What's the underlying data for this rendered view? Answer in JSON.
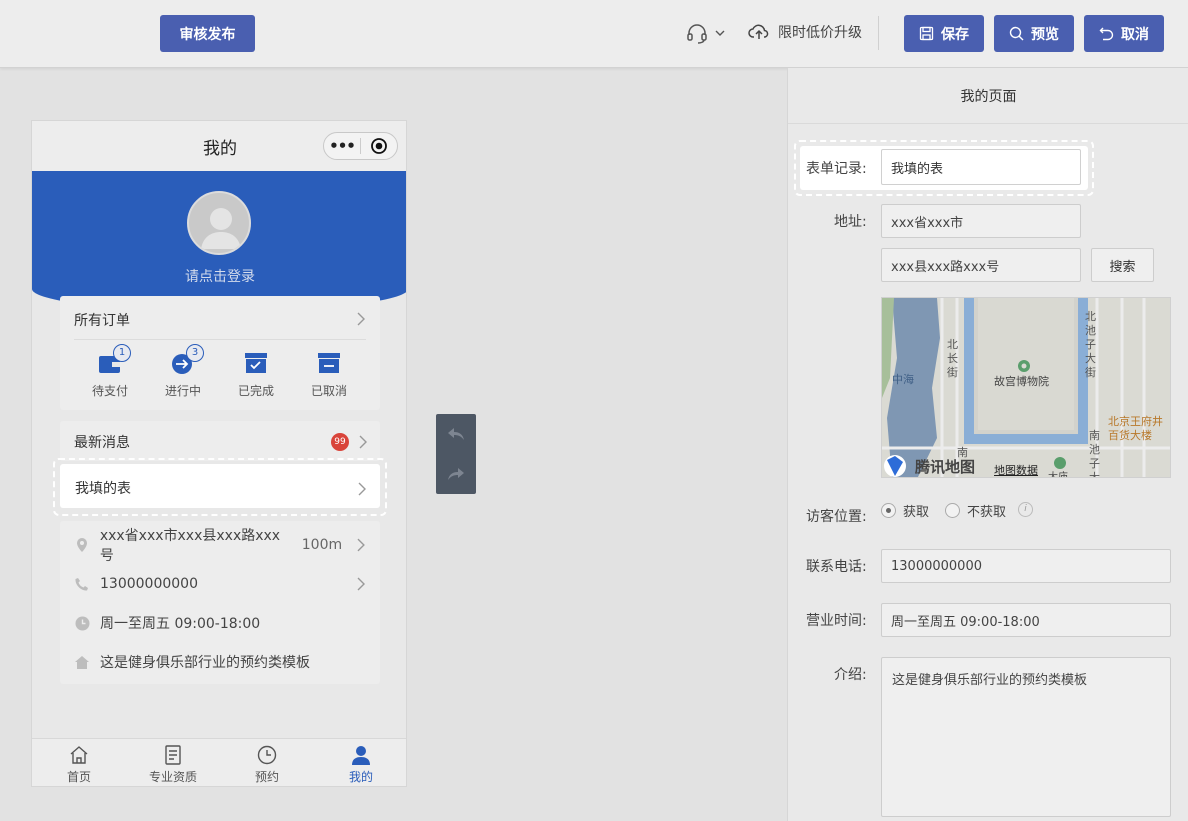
{
  "topbar": {
    "publish_label": "审核发布",
    "upgrade_label": "限时低价升级",
    "save_label": "保存",
    "preview_label": "预览",
    "cancel_label": "取消"
  },
  "phone": {
    "title": "我的",
    "capsule_dots": "•••",
    "login_text": "请点击登录",
    "orders": {
      "title": "所有订单",
      "items": [
        {
          "label": "待支付",
          "badge": "1"
        },
        {
          "label": "进行中",
          "badge": "3"
        },
        {
          "label": "已完成"
        },
        {
          "label": "已取消"
        }
      ]
    },
    "news": {
      "label": "最新消息",
      "badge": "99"
    },
    "form_item": {
      "label": "我填的表"
    },
    "info": {
      "address": "xxx省xxx市xxx县xxx路xxx号",
      "distance": "100m",
      "phone": "13000000000",
      "hours": "周一至周五 09:00-18:00",
      "intro": "这是健身俱乐部行业的预约类模板"
    },
    "tabs": [
      {
        "label": "首页"
      },
      {
        "label": "专业资质"
      },
      {
        "label": "预约"
      },
      {
        "label": "我的"
      }
    ]
  },
  "panel": {
    "title": "我的页面",
    "form_record": {
      "label": "表单记录:",
      "value": "我填的表"
    },
    "address": {
      "label": "地址:",
      "city": "xxx省xxx市",
      "street": "xxx县xxx路xxx号",
      "search_label": "搜索"
    },
    "map": {
      "labels": [
        "中海",
        "北长街",
        "故宫博物院",
        "北池子大街",
        "北京王府井百货大楼",
        "南池子大",
        "南",
        "腾讯地图",
        "地图数据",
        "大庙"
      ]
    },
    "visitor_location": {
      "label": "访客位置:",
      "options": [
        "获取",
        "不获取"
      ],
      "selected": "获取",
      "info_icon": "i"
    },
    "phone": {
      "label": "联系电话:",
      "value": "13000000000"
    },
    "hours": {
      "label": "营业时间:",
      "value": "周一至周五 09:00-18:00"
    },
    "intro": {
      "label": "介绍:",
      "value": "这是健身俱乐部行业的预约类模板"
    }
  },
  "colors": {
    "brand": "#4a5fb0",
    "phone_banner": "#2a5dba",
    "badge_red": "#d9443a"
  }
}
